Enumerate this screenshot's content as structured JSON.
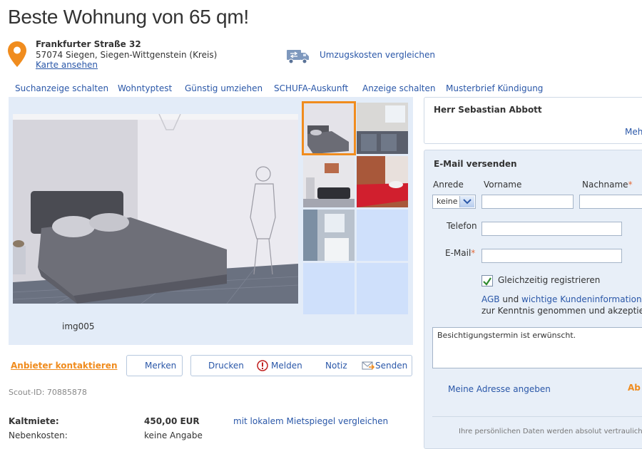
{
  "page": {
    "title": "Beste Wohnung von 65 qm!"
  },
  "address": {
    "street": "Frankfurter Straße 32",
    "city": "57074 Siegen, Siegen-Wittgenstein (Kreis)",
    "map_link": "Karte ansehen"
  },
  "moving": {
    "link": "Umzugskosten vergleichen"
  },
  "nav": {
    "items": [
      {
        "label": "Suchanzeige schalten"
      },
      {
        "label": "Wohntyptest"
      },
      {
        "label": "Günstig umziehen"
      },
      {
        "label": "SCHUFA-Auskunft"
      },
      {
        "label": "Anzeige schalten"
      },
      {
        "label": "Musterbrief Kündigung"
      }
    ]
  },
  "gallery": {
    "caption": "img005",
    "selected_thumb": 0
  },
  "actions": {
    "contact": "Anbieter kontaktieren",
    "save": "Merken",
    "print": "Drucken",
    "report": "Melden",
    "note": "Notiz",
    "send": "Senden"
  },
  "listing": {
    "scout_id": "Scout-ID: 70885878",
    "rent_label": "Kaltmiete:",
    "rent_value": "450,00 EUR",
    "mietspiegel_link": "mit lokalem Mietspiegel vergleichen",
    "extra_costs_label": "Nebenkosten:",
    "extra_costs_value": "keine Angabe"
  },
  "contact_panel": {
    "name": "Herr Sebastian Abbott",
    "more_link": "Meh"
  },
  "email_form": {
    "heading": "E-Mail versenden",
    "salutation_label": "Anrede",
    "salutation_value": "keine",
    "firstname_label": "Vorname",
    "lastname_label": "Nachname",
    "phone_label": "Telefon",
    "email_label": "E-Mail",
    "required_mark": "*",
    "register_label": "Gleichzeitig registrieren",
    "agb_link": "AGB",
    "and_text": "und",
    "customer_info_link": "wichtige Kundeninformationen",
    "accept_text": "zur Kenntnis genommen und akzeptien",
    "message": "Besichtigungstermin ist erwünscht.",
    "address_link": "Meine Adresse angeben",
    "submit_partial": "Ab",
    "privacy_text": "Ihre persönlichen Daten werden absolut vertraulich b"
  },
  "colors": {
    "link": "#2a57a8",
    "accent": "#f08c1e",
    "gallery_bg": "#e3ecf8",
    "panel_bg": "#e8eff8"
  }
}
